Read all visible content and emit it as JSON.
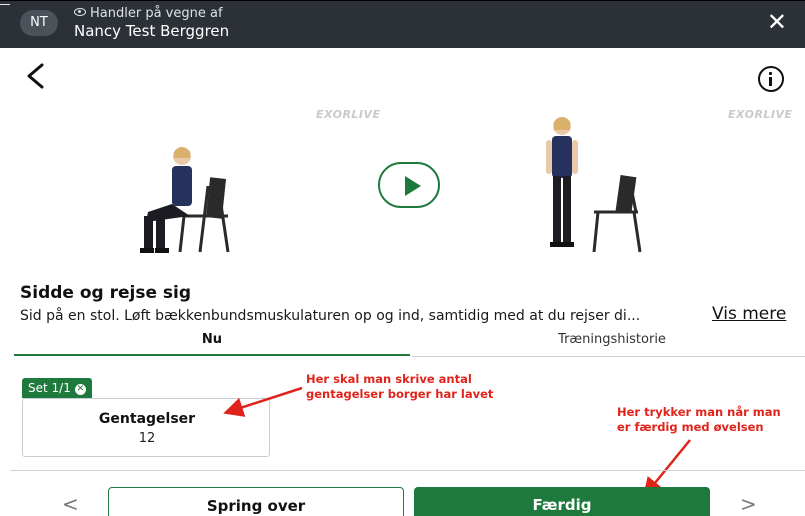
{
  "header": {
    "avatar_initials": "NT",
    "handler_label": "Handler på vegne af",
    "patient_name": "Nancy Test Berggren",
    "close_glyph": "✕"
  },
  "video": {
    "watermark": "EXORLIVE",
    "play_icon": "play-icon"
  },
  "exercise": {
    "title": "Sidde og rejse sig",
    "description": "Sid på en stol. Løft bækkenbundsmuskulaturen op og ind, samtidig med at du rejser di...",
    "show_more": "Vis mere"
  },
  "tabs": [
    {
      "label": "Nu",
      "active": true
    },
    {
      "label": "Træningshistorie",
      "active": false
    }
  ],
  "set": {
    "badge": "Set 1/1",
    "reps_label": "Gentagelser",
    "reps_value": "12"
  },
  "annotations": {
    "reps_note_line1": "Her skal man skrive antal",
    "reps_note_line2": "gentagelser borger har lavet",
    "done_note_line1": "Her trykker man når man",
    "done_note_line2": "er færdig med øvelsen"
  },
  "footer": {
    "prev_glyph": "<",
    "next_glyph": ">",
    "skip_label": "Spring over",
    "done_label": "Færdig"
  },
  "colors": {
    "accent": "#1e7a3c",
    "banner": "#2b3137",
    "annotation": "#e0241b"
  }
}
